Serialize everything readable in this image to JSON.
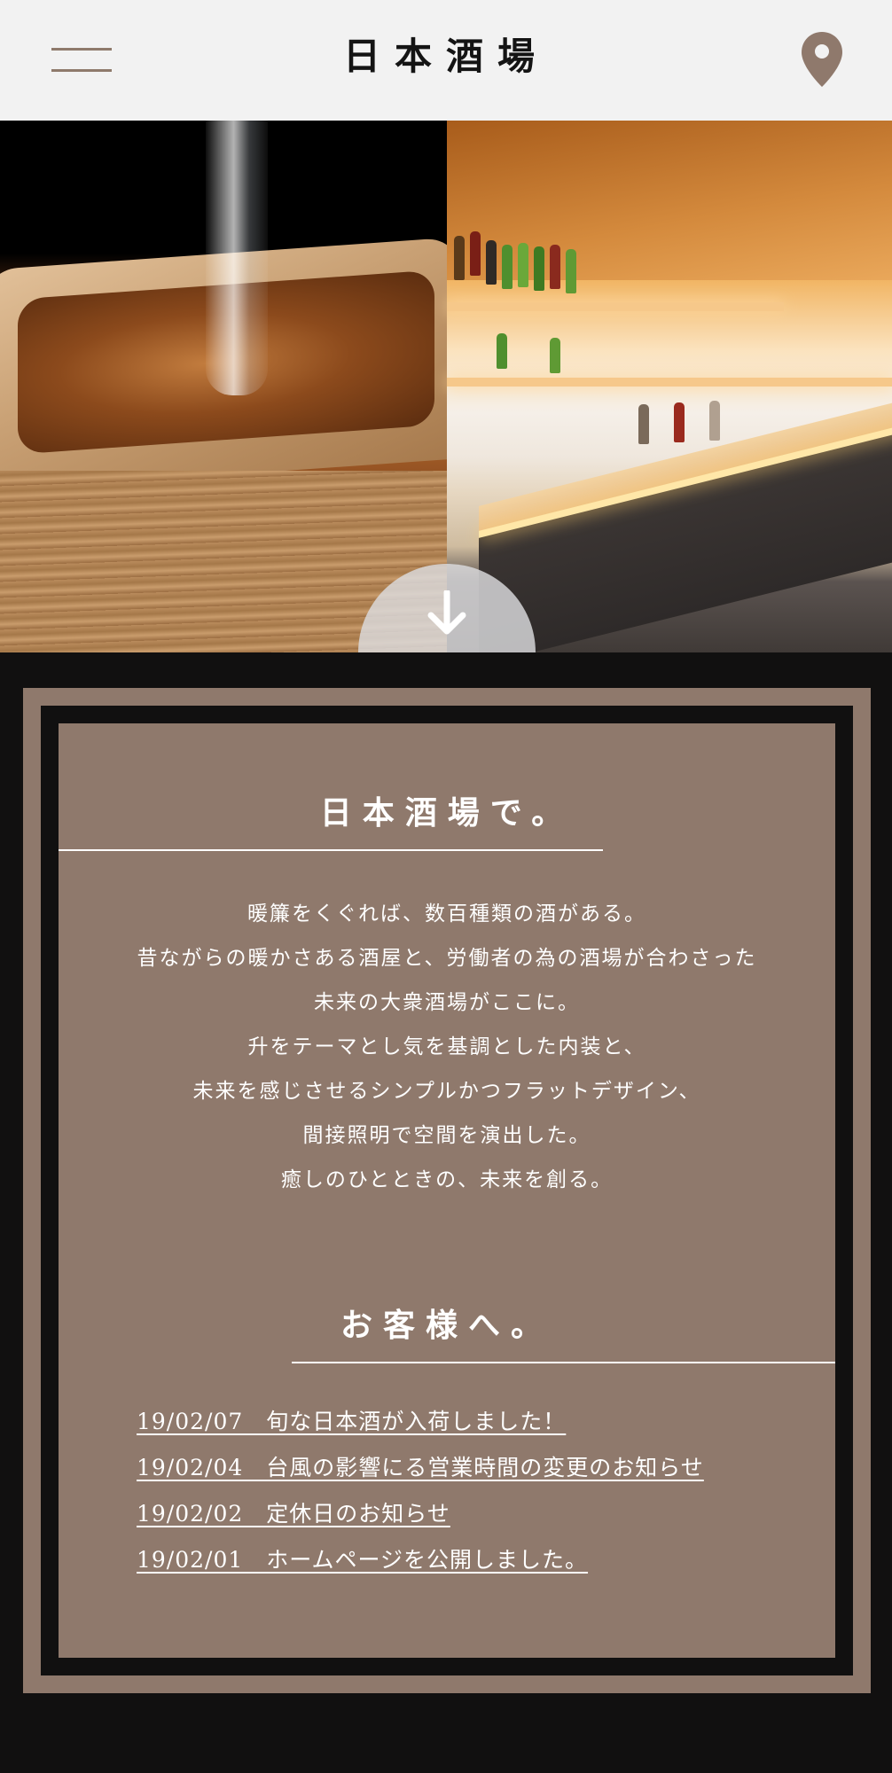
{
  "header": {
    "title": "日本酒場",
    "menu_icon": "hamburger-icon",
    "location_icon": "map-pin-icon"
  },
  "hero": {
    "scroll_icon": "arrow-down-icon"
  },
  "about": {
    "title": "日本酒場で。",
    "lines": [
      "暖簾をくぐれば、数百種類の酒がある。",
      "昔ながらの暖かさある酒屋と、労働者の為の酒場が合わさった",
      "未来の大衆酒場がここに。",
      "升をテーマとし気を基調とした内装と、",
      "未来を感じさせるシンプルかつフラットデザイン、",
      "間接照明で空間を演出した。",
      "癒しのひとときの、未来を創る。"
    ]
  },
  "news": {
    "title": "お客様へ。",
    "items": [
      "19/02/07　旬な日本酒が入荷しました！",
      "19/02/04　台風の影響にる営業時間の変更のお知らせ",
      "19/02/02　定休日のお知らせ",
      "19/02/01　ホームページを公開しました。"
    ]
  },
  "colors": {
    "accent": "#8f796c",
    "dark": "#111010",
    "header_bg": "#f2f2f2"
  }
}
